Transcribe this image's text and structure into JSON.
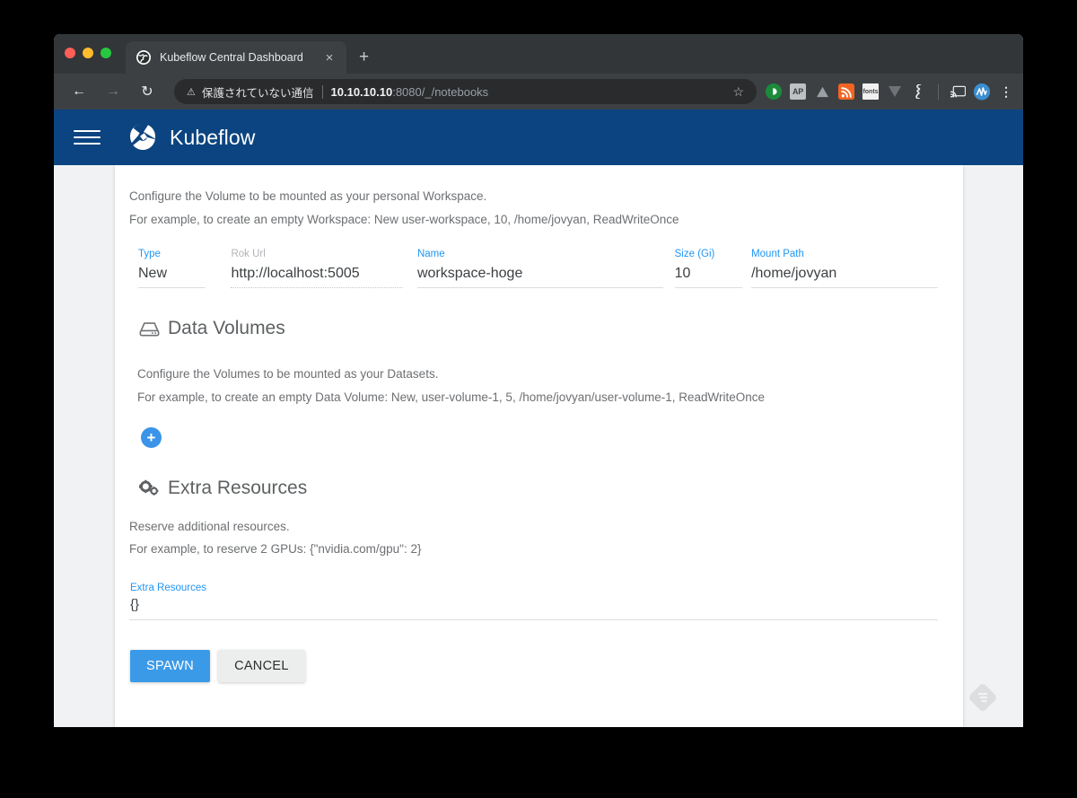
{
  "browser": {
    "tab": {
      "title": "Kubeflow Central Dashboard",
      "favicon_icon": "globe-icon",
      "close_icon": "close-icon",
      "close_label": "×"
    },
    "new_tab_label": "+",
    "nav": {
      "back_icon": "back-arrow-icon",
      "back_label": "←",
      "forward_icon": "forward-arrow-icon",
      "forward_label": "→",
      "reload_icon": "reload-icon",
      "reload_label": "↻"
    },
    "omnibox": {
      "warning_icon": "warning-triangle-icon",
      "warning_label": "⚠",
      "security_text": "保護されていない通信",
      "url_host": "10.10.10.10",
      "url_rest": ":8080/_/notebooks",
      "bookmark_icon": "star-icon",
      "bookmark_label": "☆"
    },
    "extensions": [
      {
        "name": "pocket-extension-icon",
        "label": "◐"
      },
      {
        "name": "ap-extension-icon",
        "label": "AP"
      },
      {
        "name": "drive-extension-icon",
        "label": "▲"
      },
      {
        "name": "rss-extension-icon",
        "label": "◤"
      },
      {
        "name": "fonts-extension-icon",
        "label": "fonts"
      },
      {
        "name": "v-extension-icon",
        "label": "▼"
      },
      {
        "name": "evernote-extension-icon",
        "label": "≣"
      }
    ],
    "cast_icon": "cast-icon",
    "cast_label": "◢",
    "profile_icon": "profile-avatar-icon",
    "profile_label": "Ⓐ",
    "menu_icon": "kebab-menu-icon",
    "menu_label": "⋮"
  },
  "app_header": {
    "menu_icon": "hamburger-menu-icon",
    "logo_icon": "kubeflow-logo-icon",
    "title": "Kubeflow"
  },
  "workspace": {
    "description_1": "Configure the Volume to be mounted as your personal Workspace.",
    "description_2": "For example, to create an empty Workspace: New user-workspace, 10, /home/jovyan, ReadWriteOnce",
    "fields": [
      {
        "label": "Type",
        "value": "New",
        "disabled": false,
        "control": "select"
      },
      {
        "label": "Rok Url",
        "value": "http://localhost:5005",
        "disabled": true,
        "control": "text"
      },
      {
        "label": "Name",
        "value": "workspace-hoge",
        "disabled": false,
        "control": "text"
      },
      {
        "label": "Size (Gi)",
        "value": "10",
        "disabled": false,
        "control": "text"
      },
      {
        "label": "Mount Path",
        "value": "/home/jovyan",
        "disabled": false,
        "control": "text"
      }
    ]
  },
  "data_volumes": {
    "icon": "hard-drive-icon",
    "title": "Data Volumes",
    "description_1": "Configure the Volumes to be mounted as your Datasets.",
    "description_2": "For example, to create an empty Data Volume: New, user-volume-1, 5, /home/jovyan/user-volume-1, ReadWriteOnce",
    "add_label": "+"
  },
  "extra_resources": {
    "icon": "cogs-icon",
    "title": "Extra Resources",
    "description_1": "Reserve additional resources.",
    "description_2": "For example, to reserve 2 GPUs: {\"nvidia.com/gpu\": 2}",
    "field_label": "Extra Resources",
    "field_value": "{}"
  },
  "actions": {
    "spawn_label": "SPAWN",
    "cancel_label": "CANCEL"
  },
  "colors": {
    "kubeflow_blue": "#0b4480",
    "accent_blue": "#2196f3",
    "spawn_blue": "#3b9ae8",
    "page_bg": "#f1f2f3",
    "chrome_dark": "#3c4043"
  },
  "watermark_icon": "feedly-watermark-icon"
}
